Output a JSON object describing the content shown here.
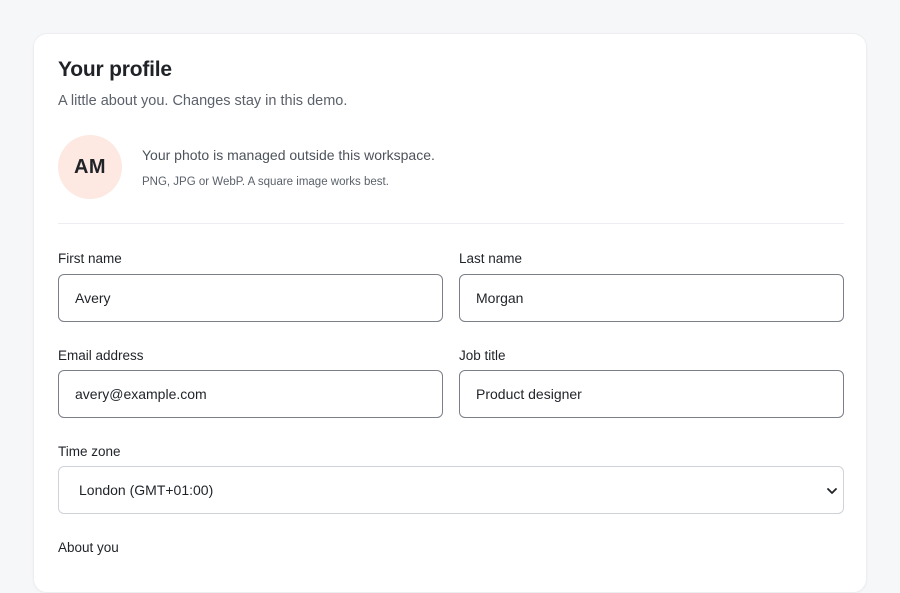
{
  "profile": {
    "title": "Your profile",
    "subtitle": "A little about you. Changes stay in this demo.",
    "avatar_initials": "AM",
    "photo_text": "Your photo is managed outside this workspace.",
    "photo_hint": "PNG, JPG or WebP. A square image works best."
  },
  "fields": {
    "first_name": {
      "label": "First name",
      "value": "Avery"
    },
    "last_name": {
      "label": "Last name",
      "value": "Morgan"
    },
    "email": {
      "label": "Email address",
      "value": "avery@example.com"
    },
    "job_title": {
      "label": "Job title",
      "value": "Product designer"
    },
    "time_zone": {
      "label": "Time zone",
      "selected": "London (GMT+01:00)"
    },
    "about": {
      "label": "About you"
    }
  },
  "colors": {
    "page_background": "#f6f7f9",
    "card_background": "#ffffff",
    "avatar_background": "#fde8e2",
    "input_border": "#7b8088",
    "select_border": "#cfd3d8",
    "text_primary": "#1f2328",
    "text_muted": "#5b616a"
  },
  "icons": {
    "select_arrow": "chevron-down-icon"
  }
}
